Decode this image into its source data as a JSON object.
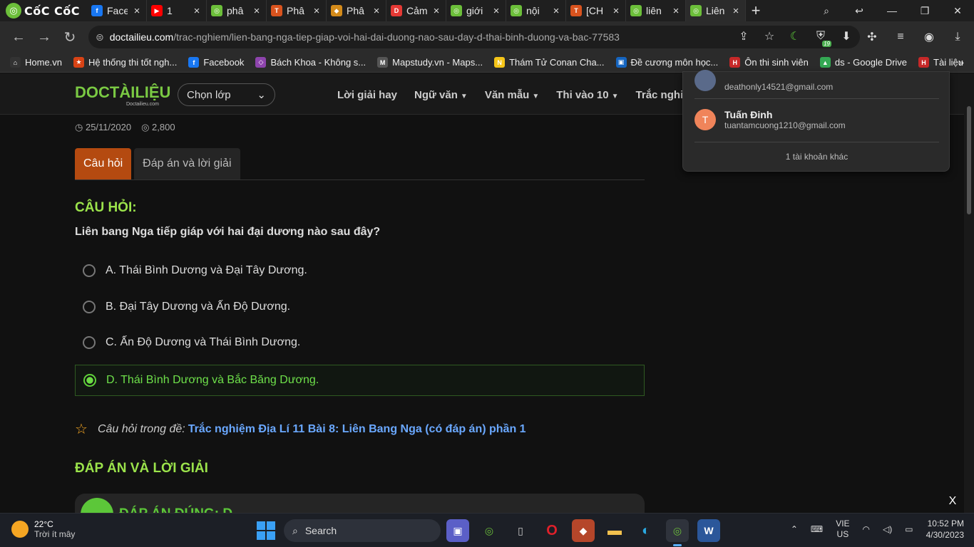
{
  "browser": {
    "brand": "CốC CốC",
    "tabs": [
      {
        "title": "Face",
        "color": "#1877f2",
        "glyph": "f"
      },
      {
        "title": "1",
        "color": "#ff0000",
        "glyph": "▶"
      },
      {
        "title": "phâ",
        "color": "#6cbf3a",
        "glyph": "◎"
      },
      {
        "title": "Phâ",
        "color": "#d9531e",
        "glyph": "T"
      },
      {
        "title": "Phâ",
        "color": "#d48b1a",
        "glyph": "◆"
      },
      {
        "title": "Cảm",
        "color": "#e53935",
        "glyph": "D"
      },
      {
        "title": "giới",
        "color": "#6cbf3a",
        "glyph": "◎"
      },
      {
        "title": "nội",
        "color": "#6cbf3a",
        "glyph": "◎"
      },
      {
        "title": "[CH",
        "color": "#d9531e",
        "glyph": "T"
      },
      {
        "title": "liên",
        "color": "#6cbf3a",
        "glyph": "◎"
      },
      {
        "title": "Liên",
        "color": "#6cbf3a",
        "glyph": "◎"
      }
    ],
    "url_host": "doctailieu.com",
    "url_path": "/trac-nghiem/lien-bang-nga-tiep-giap-voi-hai-dai-duong-nao-sau-day-d-thai-binh-duong-va-bac-77583",
    "extension_badge": "19",
    "bookmarks": [
      {
        "label": "Home.vn",
        "color": "#333",
        "glyph": "⌂"
      },
      {
        "label": "Hệ thống thi tốt ngh...",
        "color": "#d84315",
        "glyph": "★"
      },
      {
        "label": "Facebook",
        "color": "#1877f2",
        "glyph": "f"
      },
      {
        "label": "Bách Khoa - Không s...",
        "color": "#8e44ad",
        "glyph": "◇"
      },
      {
        "label": "Mapstudy.vn - Maps...",
        "color": "#555",
        "glyph": "M"
      },
      {
        "label": "Thám Tử Conan Cha...",
        "color": "#f5c518",
        "glyph": "N"
      },
      {
        "label": "Đề cương môn học...",
        "color": "#1565c0",
        "glyph": "▣"
      },
      {
        "label": "Ôn thi sinh viên",
        "color": "#c62828",
        "glyph": "H"
      },
      {
        "label": "ds - Google Drive",
        "color": "#34a853",
        "glyph": "▲"
      },
      {
        "label": "Tài liệu",
        "color": "#c62828",
        "glyph": "H"
      }
    ]
  },
  "site": {
    "logo": "DOCTÀILIỆU",
    "logo_sub": "Doctailieu.com",
    "class_select": "Chọn lớp",
    "nav": [
      {
        "label": "Lời giải hay",
        "dropdown": false
      },
      {
        "label": "Ngữ văn",
        "dropdown": true
      },
      {
        "label": "Văn mẫu",
        "dropdown": true
      },
      {
        "label": "Thi vào 10",
        "dropdown": true
      },
      {
        "label": "Trắc nghiệm",
        "dropdown": false
      }
    ]
  },
  "post": {
    "date": "25/11/2020",
    "views": "2,800",
    "tab_question": "Câu hỏi",
    "tab_answer": "Đáp án và lời giải",
    "question_heading": "CÂU HỎI:",
    "question": "Liên bang Nga tiếp giáp với hai đại dương nào sau đây?",
    "options": [
      {
        "text": "A. Thái Bình Dương và Đại Tây Dương.",
        "correct": false
      },
      {
        "text": "B. Đại Tây Dương và Ấn Độ Dương.",
        "correct": false
      },
      {
        "text": "C. Ấn Độ Dương và Thái Bình Dương.",
        "correct": false
      },
      {
        "text": "D. Thái Bình Dương và Bắc Băng Dương.",
        "correct": true
      }
    ],
    "source_label": "Câu hỏi trong đề:",
    "source_link": "Trắc nghiệm Địa Lí 11 Bài 8: Liên Bang Nga (có đáp án) phần 1",
    "answer_heading": "ĐÁP ÁN VÀ LỜI GIẢI",
    "answer_box": "ĐÁP ÁN ĐÚNG: D"
  },
  "profile_menu": {
    "accounts": [
      {
        "name": "",
        "email": "deathonly14521@gmail.com",
        "initial": "",
        "color": "#5a6a8a"
      },
      {
        "name": "Tuấn Đinh",
        "email": "tuantamcuong1210@gmail.com",
        "initial": "T",
        "color": "#f0845a"
      }
    ],
    "more": "1 tài khoản khác"
  },
  "ad_close": "X",
  "taskbar": {
    "temp": "22°C",
    "weather": "Trời ít mây",
    "search": "Search",
    "lang_top": "VIE",
    "lang_bottom": "US",
    "time": "10:52 PM",
    "date": "4/30/2023"
  }
}
